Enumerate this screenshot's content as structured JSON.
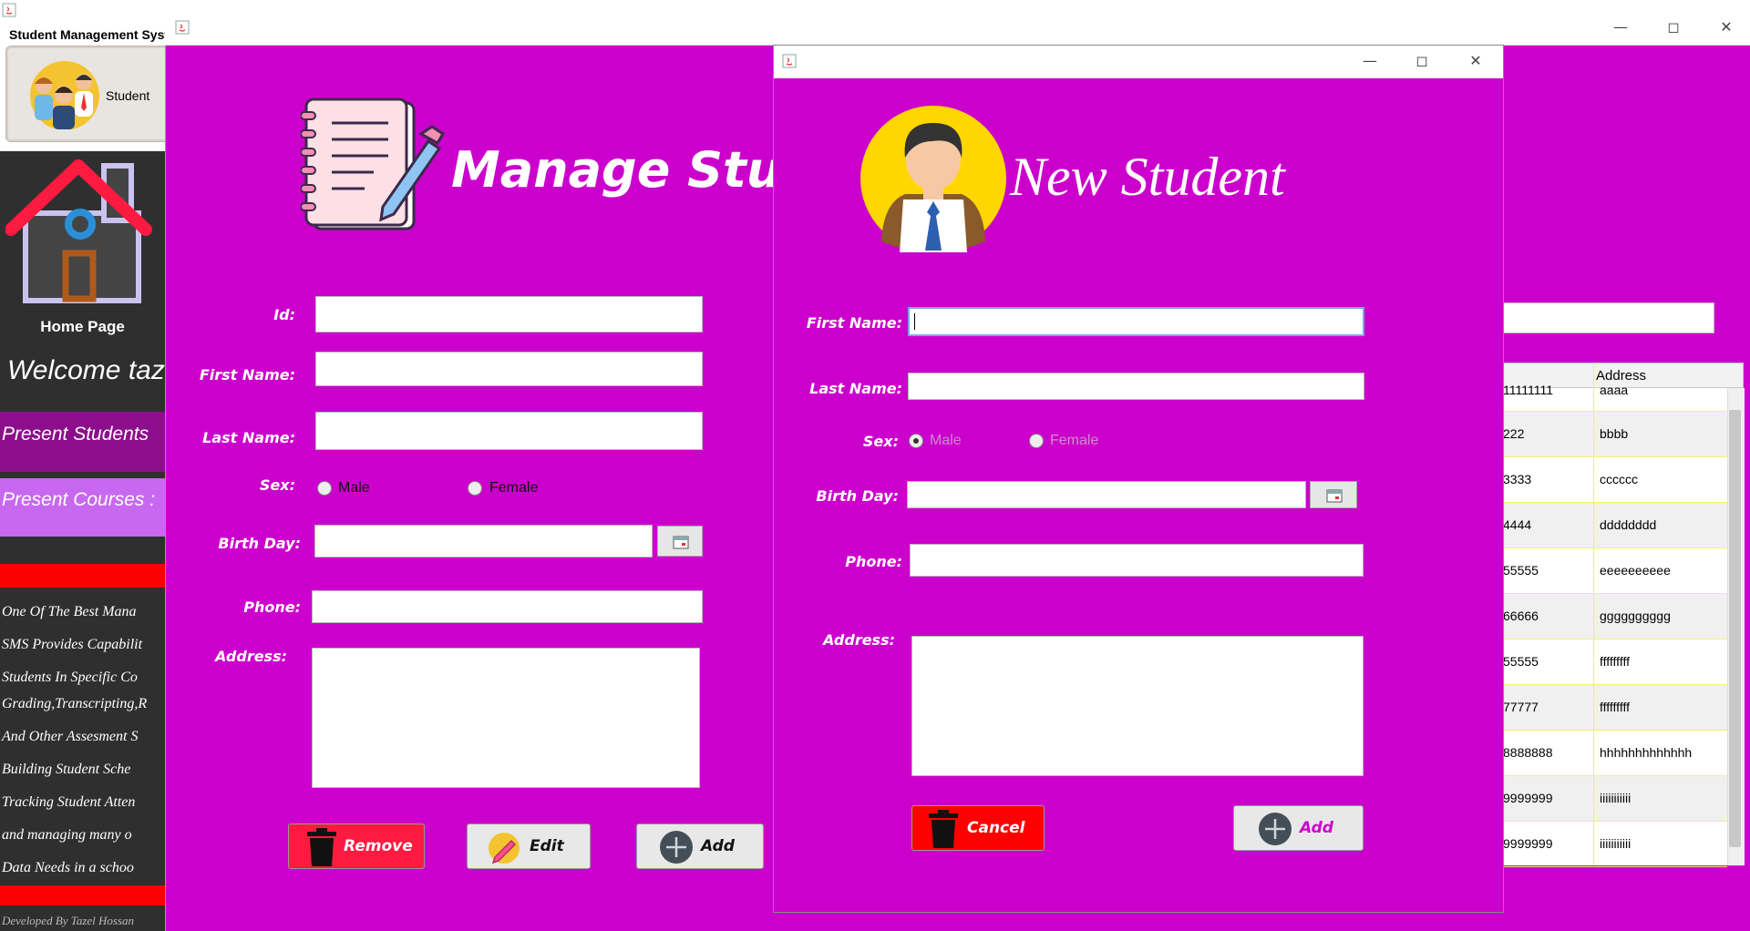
{
  "app": {
    "title": "Student Management System",
    "student_tile_label": "Student"
  },
  "sidebar": {
    "home_label": "Home Page",
    "welcome": "Welcome taze",
    "present_students": "Present Students",
    "present_courses": "Present Courses :",
    "descriptions": [
      "One Of The Best Mana",
      "SMS Provides Capabilit",
      "Students In Specific Co",
      "Grading,Transcripting,R",
      "And Other Assesment S",
      " Building Student Sche",
      "Tracking Student Atten",
      " and managing many o",
      " Data Needs in a schoo"
    ],
    "footer": "Developed By Tazel Hossan"
  },
  "manage": {
    "title": "Manage Stude",
    "labels": {
      "id": "Id:",
      "first_name": "First Name:",
      "last_name": "Last Name:",
      "sex": "Sex:",
      "birthday": "Birth Day:",
      "phone": "Phone:",
      "address": "Address:"
    },
    "values": {
      "id": "",
      "first_name": "",
      "last_name": "",
      "birthday": "",
      "phone": "",
      "address": ""
    },
    "sex_options": {
      "male": "Male",
      "female": "Female"
    },
    "buttons": {
      "remove": "Remove",
      "edit": "Edit",
      "add": "Add"
    }
  },
  "table": {
    "header_address": "Address",
    "rows": [
      {
        "a": "11111111",
        "b": "aaaa"
      },
      {
        "a": "222",
        "b": "bbbb"
      },
      {
        "a": "3333",
        "b": "cccccc"
      },
      {
        "a": "4444",
        "b": "dddddddd"
      },
      {
        "a": "55555",
        "b": "eeeeeeeeee"
      },
      {
        "a": "66666",
        "b": "gggggggggg"
      },
      {
        "a": "55555",
        "b": "fffffffff"
      },
      {
        "a": "77777",
        "b": "fffffffff"
      },
      {
        "a": "8888888",
        "b": "hhhhhhhhhhhhh"
      },
      {
        "a": "9999999",
        "b": "iiiiiiiiiii"
      },
      {
        "a": "9999999",
        "b": "iiiiiiiiiii"
      }
    ]
  },
  "dialog": {
    "title": "New Student",
    "labels": {
      "first_name": "First Name:",
      "last_name": "Last Name:",
      "sex": "Sex:",
      "birthday": "Birth Day:",
      "phone": "Phone:",
      "address": "Address:"
    },
    "values": {
      "first_name": "",
      "last_name": "",
      "birthday": "",
      "phone": "",
      "address": ""
    },
    "sex_options": {
      "male": "Male",
      "female": "Female"
    },
    "selected_sex": "Male",
    "buttons": {
      "cancel": "Cancel",
      "add": "Add"
    }
  },
  "colors": {
    "magenta": "#cc00cc",
    "dark": "#2f2f2f",
    "red": "#ff0000",
    "remove_red": "#ff1a40",
    "purple": "#8c0e8c",
    "lavender": "#c868f0"
  }
}
